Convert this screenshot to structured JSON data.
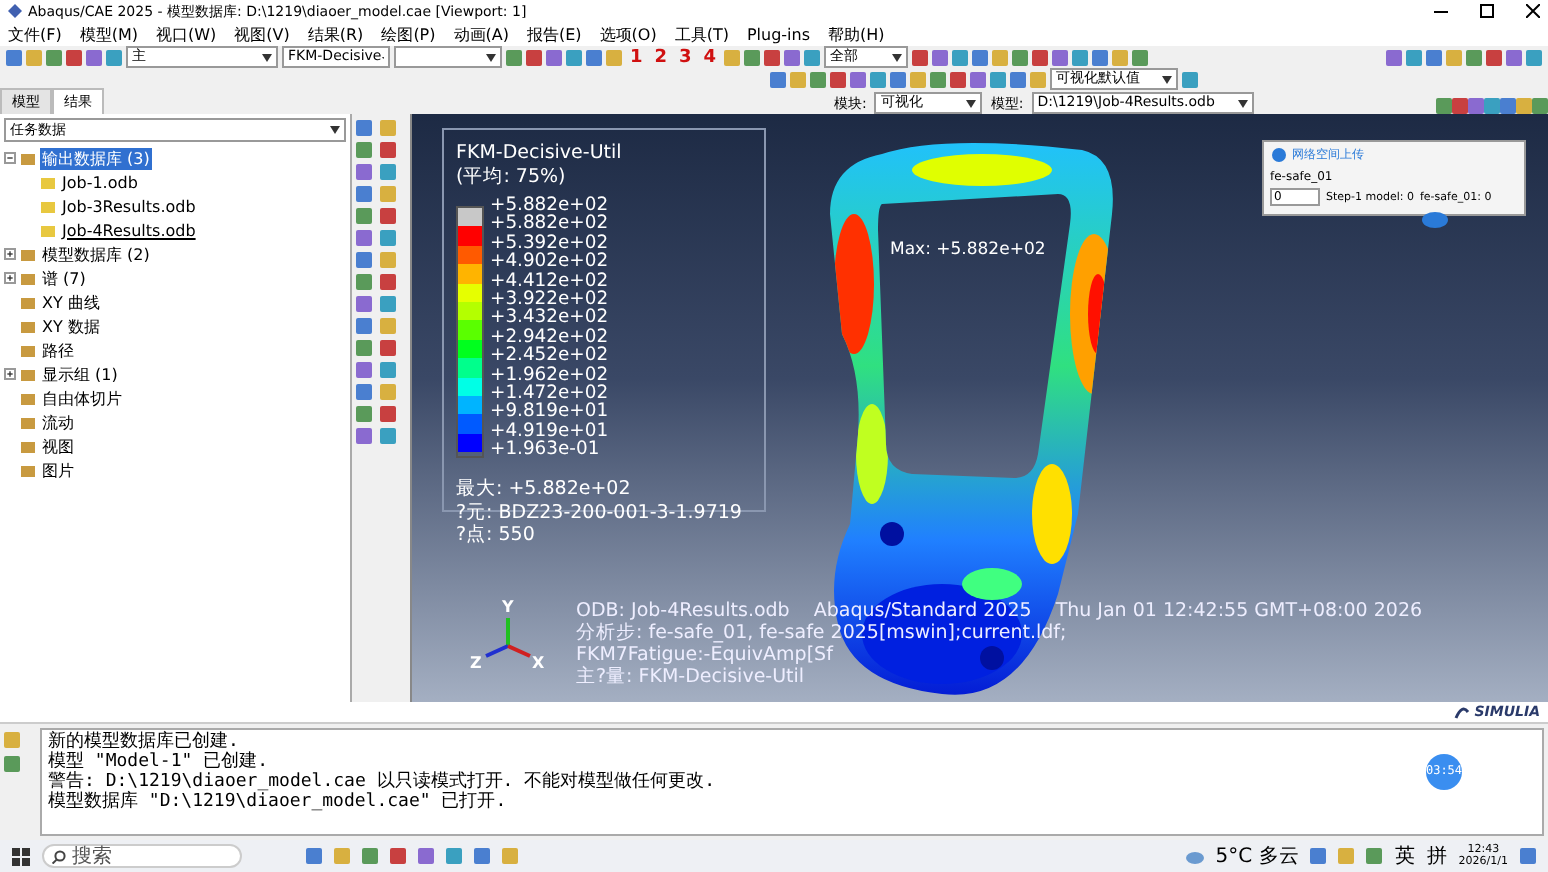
{
  "window": {
    "title": "Abaqus/CAE 2025 - 模型数据库: D:\\1219\\diaoer_model.cae [Viewport: 1]"
  },
  "menu": [
    "文件(F)",
    "模型(M)",
    "视口(W)",
    "视图(V)",
    "结果(R)",
    "绘图(P)",
    "动画(A)",
    "报告(E)",
    "选项(O)",
    "工具(T)",
    "Plug-ins",
    "帮助(H)"
  ],
  "toolbar": {
    "combos": [
      {
        "value": "主"
      },
      {
        "value": "FKM-Decisive"
      }
    ],
    "numbers": [
      "1",
      "2",
      "3",
      "4"
    ],
    "select_combo": "全部",
    "defaults_combo": "可视化默认值"
  },
  "tabs": [
    {
      "label": "模型",
      "selected": false
    },
    {
      "label": "结果",
      "selected": true
    }
  ],
  "module_bar": {
    "module_label": "模块:",
    "module": "可视化",
    "model_label": "模型:",
    "model": "D:\\1219\\Job-4Results.odb"
  },
  "tree": {
    "filter": "任务数据",
    "items": [
      {
        "label": "输出数据库 (3)",
        "selected": true,
        "expanded": true,
        "children": [
          {
            "label": "Job-1.odb",
            "current": false
          },
          {
            "label": "Job-3Results.odb",
            "current": false
          },
          {
            "label": "Job-4Results.odb",
            "current": true
          }
        ]
      },
      {
        "label": "模型数据库 (2)",
        "selected": false,
        "expanded": false
      },
      {
        "label": "谱 (7)",
        "selected": false,
        "expanded": false
      },
      {
        "label": "XY 曲线",
        "selected": false
      },
      {
        "label": "XY 数据",
        "selected": false
      },
      {
        "label": "路径",
        "selected": false
      },
      {
        "label": "显示组 (1)",
        "selected": false,
        "expanded": false
      },
      {
        "label": "自由体切片",
        "selected": false
      },
      {
        "label": "流动",
        "selected": false
      },
      {
        "label": "视图",
        "selected": false
      },
      {
        "label": "图片",
        "selected": false
      }
    ]
  },
  "legend": {
    "title": "FKM-Decisive-Util",
    "subtitle": "(平均: 75%)",
    "bands": [
      {
        "color": "#c8c8c8"
      },
      {
        "color": "#ff0000"
      },
      {
        "color": "#ff5a00"
      },
      {
        "color": "#ffb400"
      },
      {
        "color": "#e6ff00"
      },
      {
        "color": "#b4ff00"
      },
      {
        "color": "#5aff00"
      },
      {
        "color": "#00ff1e"
      },
      {
        "color": "#00ff8c"
      },
      {
        "color": "#00ffe6"
      },
      {
        "color": "#00b4ff"
      },
      {
        "color": "#005aff"
      },
      {
        "color": "#0000ff"
      }
    ],
    "ticks": [
      "+5.882e+02",
      "+5.882e+02",
      "+5.392e+02",
      "+4.902e+02",
      "+4.412e+02",
      "+3.922e+02",
      "+3.432e+02",
      "+2.942e+02",
      "+2.452e+02",
      "+1.962e+02",
      "+1.472e+02",
      "+9.819e+01",
      "+4.919e+01",
      "+1.963e-01"
    ],
    "info": [
      "最大: +5.882e+02",
      "?元: BDZ23-200-001-3-1.9719",
      "?点: 550"
    ]
  },
  "max_label": "Max: +5.882e+02",
  "popup": {
    "title": "网络空间上传",
    "field": "fe-safe_01",
    "value": "0",
    "step": "Step-1 model: 0",
    "result": "fe-safe_01: 0"
  },
  "triad": {
    "y": "Y",
    "z": "Z",
    "x": "X"
  },
  "odb_info": {
    "odb": "ODB: Job-4Results.odb",
    "solver": "Abaqus/Standard 2025",
    "date": "Thu Jan 01 12:42:55 GMT+08:00 2026",
    "lines": [
      "分析步: fe-safe_01, fe-safe 2025[mswin];current.ldf;",
      "FKM7Fatigue:-EquivAmp[Sf",
      "主?量: FKM-Decisive-Util"
    ]
  },
  "brand": "SIMULIA",
  "messages": [
    "新的模型数据库已创建.",
    "模型 \"Model-1\" 已创建.",
    "警告: D:\\1219\\diaoer_model.cae 以只读模式打开. 不能对模型做任何更改.",
    "模型数据库 \"D:\\1219\\diaoer_model.cae\" 已打开."
  ],
  "timer": "03:54",
  "taskbar": {
    "search_placeholder": "搜索",
    "weather": "5°C 多云",
    "lang": "英",
    "ime": "拼",
    "time": "12:43",
    "date": "2026/1/1"
  }
}
